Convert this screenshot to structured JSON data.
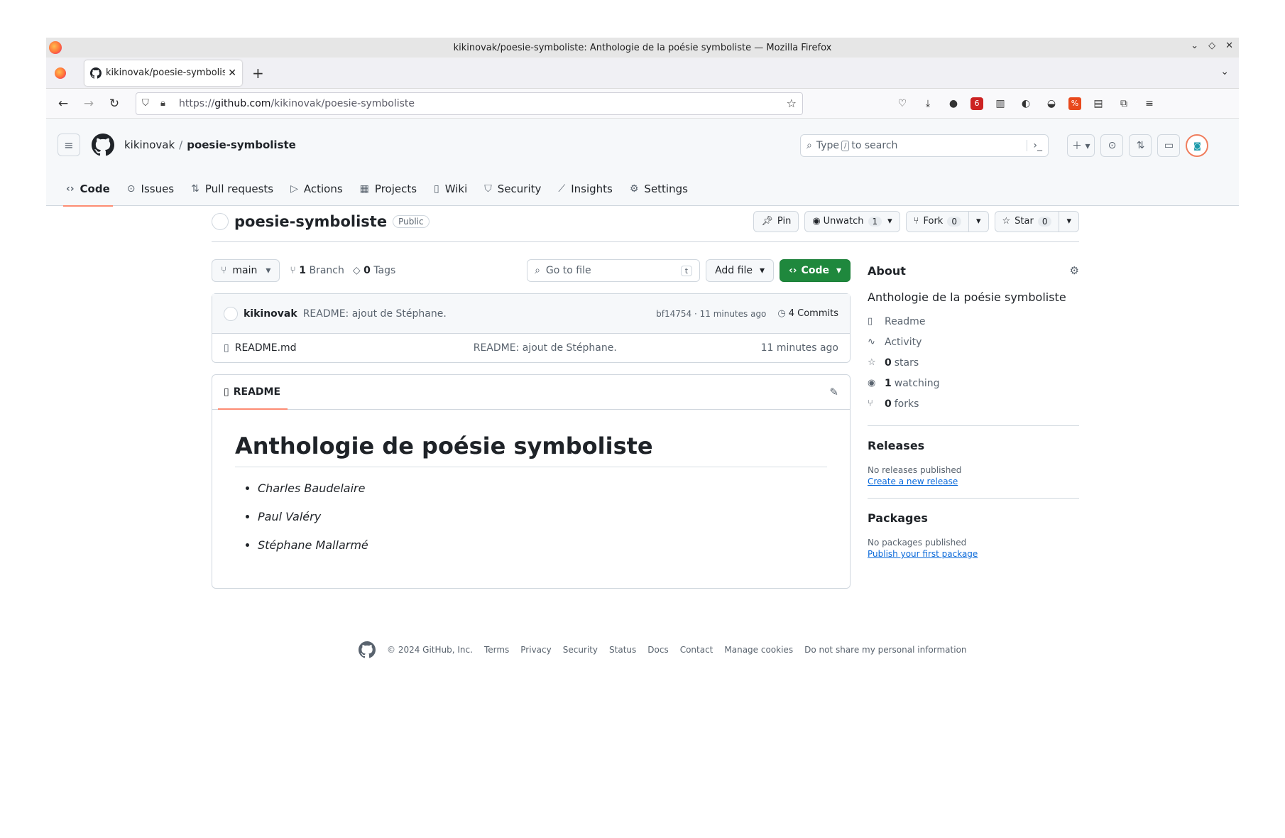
{
  "browser": {
    "window_title": "kikinovak/poesie-symboliste: Anthologie de la poésie symboliste — Mozilla Firefox",
    "tab_title": "kikinovak/poesie-symboliste",
    "url_prefix": "https://",
    "url_domain": "github.com",
    "url_path": "/kikinovak/poesie-symboliste",
    "badge_count": "6"
  },
  "header": {
    "owner": "kikinovak",
    "separator": "/",
    "repo": "poesie-symboliste",
    "search_prefix": "Type",
    "search_key": "/",
    "search_suffix": "to search"
  },
  "repo_nav": {
    "code": "Code",
    "issues": "Issues",
    "pulls": "Pull requests",
    "actions": "Actions",
    "projects": "Projects",
    "wiki": "Wiki",
    "security": "Security",
    "insights": "Insights",
    "settings": "Settings"
  },
  "repo_head": {
    "name": "poesie-symboliste",
    "visibility": "Public",
    "pin": "Pin",
    "unwatch": "Unwatch",
    "watch_count": "1",
    "fork": "Fork",
    "fork_count": "0",
    "star": "Star",
    "star_count": "0"
  },
  "filebar": {
    "branch": "main",
    "branch_count": "1",
    "branch_label": "Branch",
    "tag_count": "0",
    "tag_label": "Tags",
    "goto_placeholder": "Go to file",
    "goto_key": "t",
    "add_file": "Add file",
    "code": "Code"
  },
  "commit": {
    "author": "kikinovak",
    "message": "README: ajout de Stéphane.",
    "hash_time": "bf14754 · 11 minutes ago",
    "commits": "4 Commits"
  },
  "files": [
    {
      "name": "README.md",
      "message": "README: ajout de Stéphane.",
      "age": "11 minutes ago"
    }
  ],
  "readme": {
    "tab": "README",
    "title": "Anthologie de poésie symboliste",
    "items": [
      "Charles Baudelaire",
      "Paul Valéry",
      "Stéphane Mallarmé"
    ]
  },
  "about": {
    "heading": "About",
    "description": "Anthologie de la poésie symboliste",
    "readme": "Readme",
    "activity": "Activity",
    "stars_count": "0",
    "stars": "stars",
    "watching_count": "1",
    "watching": "watching",
    "forks_count": "0",
    "forks": "forks"
  },
  "releases": {
    "heading": "Releases",
    "none": "No releases published",
    "link": "Create a new release"
  },
  "packages": {
    "heading": "Packages",
    "none": "No packages published",
    "link": "Publish your first package"
  },
  "footer": {
    "copyright": "© 2024 GitHub, Inc.",
    "links": [
      "Terms",
      "Privacy",
      "Security",
      "Status",
      "Docs",
      "Contact",
      "Manage cookies",
      "Do not share my personal information"
    ]
  },
  "colors": {
    "accent_green": "#1f883d",
    "underline": "#fd8c73",
    "link": "#0969da"
  }
}
